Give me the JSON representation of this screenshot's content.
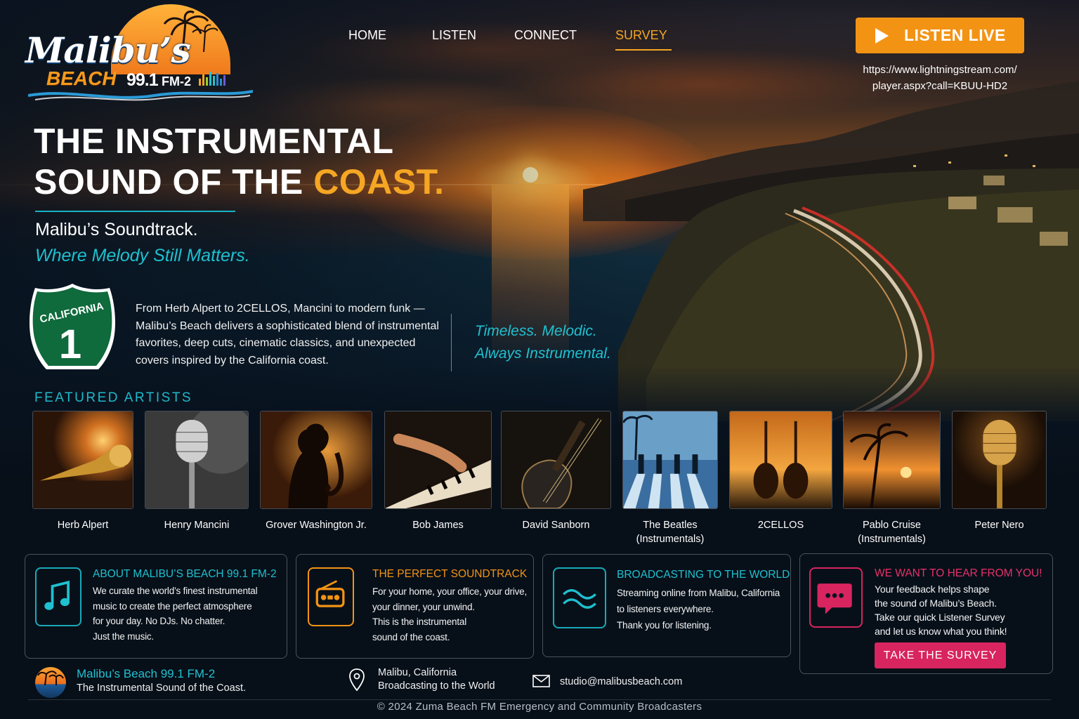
{
  "brand": {
    "logo_title": "Malibu’s",
    "logo_beach": "BEACH",
    "logo_freq": "99.1",
    "logo_band": "FM-2",
    "accent": "#f5a623",
    "teal": "#1fb9c9",
    "pink": "#d8245f"
  },
  "nav": {
    "items": [
      {
        "label": "HOME",
        "active": false
      },
      {
        "label": "LISTEN",
        "active": false
      },
      {
        "label": "CONNECT",
        "active": false
      },
      {
        "label": "SURVEY",
        "active": true
      }
    ],
    "listen_live_label": "LISTEN LIVE",
    "listen_live_icon": "play-icon",
    "stream_url_line1": "https://www.lightningstream.com/",
    "stream_url_line2": "player.aspx?call=KBUU-HD2"
  },
  "hero": {
    "headline_line1": "THE INSTRUMENTAL",
    "headline_line2_prefix": "SOUND OF THE ",
    "headline_line2_accent": "COAST.",
    "tagline": "Malibu’s Soundtrack.",
    "tagline_italic": "Where Melody Still Matters.",
    "shield_state": "CALIFORNIA",
    "shield_number": "1",
    "intro": "From Herb Alpert to 2CELLOS, Mancini to modern funk — Malibu’s Beach delivers a sophisticated blend of instrumental favorites, deep cuts, cinematic classics, and unexpected covers inspired by the California coast.",
    "slogan_line1": "Timeless. Melodic.",
    "slogan_line2": "Always Instrumental."
  },
  "featured": {
    "title": "FEATURED ARTISTS",
    "artists": [
      {
        "name": "Herb Alpert",
        "icon": "trumpet-photo"
      },
      {
        "name": "Henry Mancini",
        "icon": "microphone-photo"
      },
      {
        "name": "Grover Washington Jr.",
        "icon": "saxophone-photo"
      },
      {
        "name": "Bob James",
        "icon": "piano-photo"
      },
      {
        "name": "David Sanborn",
        "icon": "guitar-photo"
      },
      {
        "name": "The Beatles\n(Instrumentals)",
        "icon": "crosswalk-photo"
      },
      {
        "name": "2CELLOS",
        "icon": "cellos-photo"
      },
      {
        "name": "Pablo Cruise\n(Instrumentals)",
        "icon": "palm-sunset-photo"
      },
      {
        "name": "Peter Nero",
        "icon": "gold-microphone-photo"
      }
    ]
  },
  "cards": {
    "about": {
      "title": "ABOUT MALIBU’S BEACH 99.1 FM-2",
      "lines": [
        "We curate the world’s finest instrumental",
        "music to create the perfect atmosphere",
        "for your day. No DJs. No chatter.",
        "Just the music."
      ],
      "icon": "music-note-icon"
    },
    "soundtrack": {
      "title": "THE PERFECT SOUNDTRACK",
      "lines": [
        "For your home, your office, your drive,",
        "your dinner, your unwind.",
        "This is the instrumental",
        "sound of the coast."
      ],
      "icon": "radio-icon"
    },
    "world": {
      "title": "BROADCASTING TO THE WORLD",
      "lines": [
        "Streaming online from Malibu, California",
        "to listeners everywhere.",
        "Thank you for listening."
      ],
      "icon": "waves-icon"
    },
    "survey": {
      "title": "WE WANT TO HEAR FROM YOU!",
      "lines": [
        "Your feedback helps shape",
        "the sound of Malibu’s Beach.",
        "Take our quick Listener Survey",
        "and let us know what you think!"
      ],
      "icon": "chat-bubble-icon",
      "button": "TAKE THE SURVEY"
    }
  },
  "footer": {
    "name": "Malibu’s Beach 99.1 FM-2",
    "tag": "The Instrumental Sound of the Coast.",
    "location_line1": "Malibu, California",
    "location_line2": "Broadcasting to the World",
    "email": "studio@malibusbeach.com",
    "copyright": "© 2024 Zuma Beach FM Emergency and Community Broadcasters"
  }
}
